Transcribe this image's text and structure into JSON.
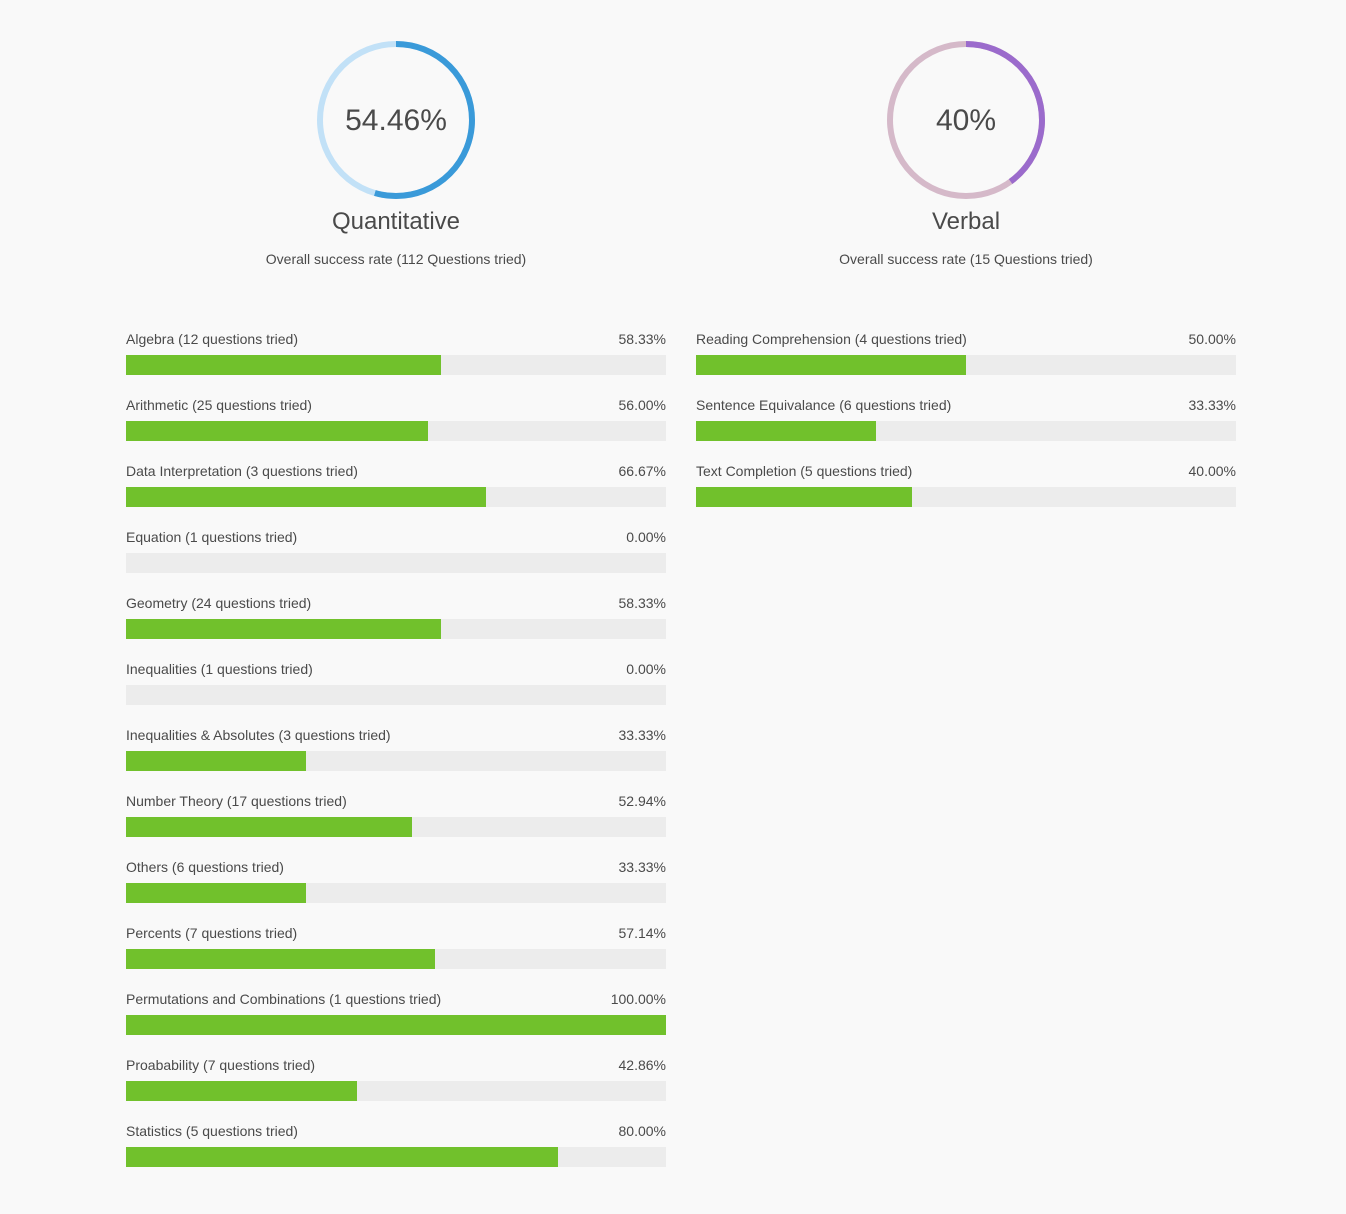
{
  "quantitative": {
    "value_text": "54.46%",
    "fraction": 0.5446,
    "title": "Quantitative",
    "subtitle": "Overall success rate (112 Questions tried)",
    "colors": {
      "track": "#c2e1f7",
      "fill": "#3a9ad9"
    },
    "topics": [
      {
        "label": "Algebra (12 questions tried)",
        "value_text": "58.33%",
        "value": 58.33
      },
      {
        "label": "Arithmetic (25 questions tried)",
        "value_text": "56.00%",
        "value": 56.0
      },
      {
        "label": "Data Interpretation (3 questions tried)",
        "value_text": "66.67%",
        "value": 66.67
      },
      {
        "label": "Equation (1 questions tried)",
        "value_text": "0.00%",
        "value": 0.0
      },
      {
        "label": "Geometry (24 questions tried)",
        "value_text": "58.33%",
        "value": 58.33
      },
      {
        "label": "Inequalities (1 questions tried)",
        "value_text": "0.00%",
        "value": 0.0
      },
      {
        "label": "Inequalities & Absolutes (3 questions tried)",
        "value_text": "33.33%",
        "value": 33.33
      },
      {
        "label": "Number Theory (17 questions tried)",
        "value_text": "52.94%",
        "value": 52.94
      },
      {
        "label": "Others (6 questions tried)",
        "value_text": "33.33%",
        "value": 33.33
      },
      {
        "label": "Percents (7 questions tried)",
        "value_text": "57.14%",
        "value": 57.14
      },
      {
        "label": "Permutations and Combinations (1 questions tried)",
        "value_text": "100.00%",
        "value": 100.0
      },
      {
        "label": "Proabability (7 questions tried)",
        "value_text": "42.86%",
        "value": 42.86
      },
      {
        "label": "Statistics (5 questions tried)",
        "value_text": "80.00%",
        "value": 80.0
      }
    ]
  },
  "verbal": {
    "value_text": "40%",
    "fraction": 0.4,
    "title": "Verbal",
    "subtitle": "Overall success rate (15 Questions tried)",
    "colors": {
      "track": "#d5b9c9",
      "fill": "#9b6bcc"
    },
    "topics": [
      {
        "label": "Reading Comprehension (4 questions tried)",
        "value_text": "50.00%",
        "value": 50.0
      },
      {
        "label": "Sentence Equivalance (6 questions tried)",
        "value_text": "33.33%",
        "value": 33.33
      },
      {
        "label": "Text Completion (5 questions tried)",
        "value_text": "40.00%",
        "value": 40.0
      }
    ]
  },
  "bar_colors": {
    "fill": "#71c12c",
    "track": "#ececec"
  }
}
